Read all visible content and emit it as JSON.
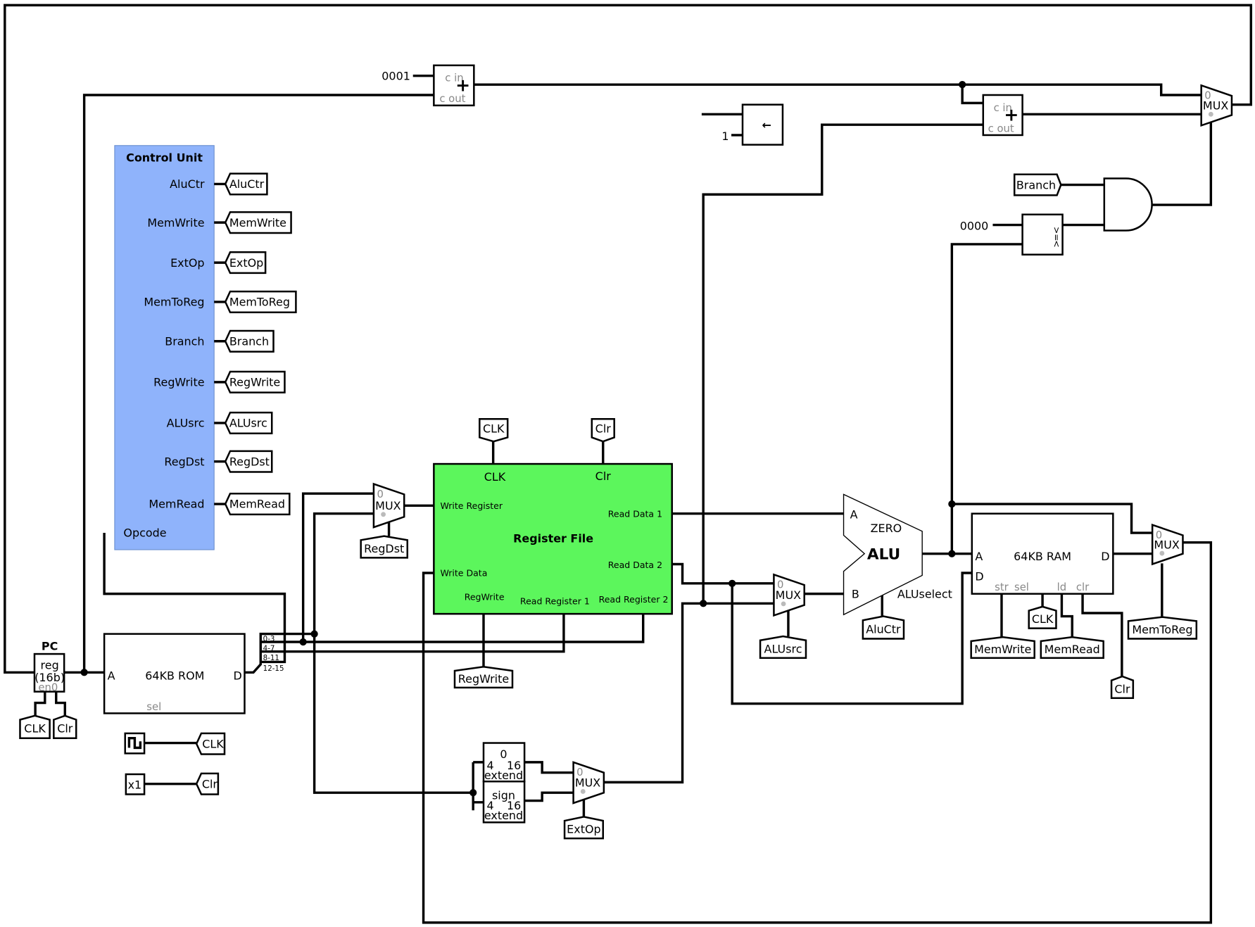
{
  "control_unit": {
    "title": "Control Unit",
    "outputs": [
      "AluCtr",
      "MemWrite",
      "ExtOp",
      "MemToReg",
      "Branch",
      "RegWrite",
      "ALUsrc",
      "RegDst",
      "MemRead"
    ],
    "input": "Opcode",
    "fill_color": "#8fb3fb"
  },
  "constants": {
    "one_hex": "0001",
    "zero_hex": "0000",
    "one": "1",
    "x1": "x1"
  },
  "adder": {
    "cin": "c in",
    "cout": "c out",
    "plus": "+"
  },
  "shift": {
    "arrow": "←"
  },
  "comparator": {
    "gt": ">",
    "eq": "=",
    "lt": "<"
  },
  "mux": {
    "label": "MUX",
    "zero": "0"
  },
  "pc": {
    "title": "PC",
    "line1": "reg",
    "line2": "(16b)",
    "en": "en0"
  },
  "rom": {
    "a": "A",
    "title": "64KB ROM",
    "d": "D",
    "sel": "sel"
  },
  "splitter": [
    "0-3",
    "4-7",
    "8-11",
    "12-15"
  ],
  "register_file": {
    "title": "Register File",
    "clk": "CLK",
    "clr": "Clr",
    "write_register": "Write Register",
    "read_data_1": "Read Data 1",
    "read_data_2": "Read Data 2",
    "write_data": "Write Data",
    "regwrite": "RegWrite",
    "read_register_1": "Read Register 1",
    "read_register_2": "Read Register 2",
    "fill_color": "#5cf65c"
  },
  "alu": {
    "a": "A",
    "b": "B",
    "zero": "ZERO",
    "title": "ALU",
    "select": "ALUselect"
  },
  "ram": {
    "a": "A",
    "d_in": "D",
    "title": "64KB RAM",
    "d_out": "D",
    "str": "str",
    "sel": "sel",
    "ld": "ld",
    "clr": "clr"
  },
  "zero_extend": {
    "top": "0",
    "bits_in": "4",
    "bits_out": "16",
    "bottom": "extend"
  },
  "sign_extend": {
    "top": "sign",
    "bits_in": "4",
    "bits_out": "16",
    "bottom": "extend"
  },
  "tunnels": {
    "clk": "CLK",
    "clr": "Clr",
    "branch": "Branch",
    "regdst": "RegDst",
    "regwrite": "RegWrite",
    "alusrc": "ALUsrc",
    "aluctr": "AluCtr",
    "memwrite": "MemWrite",
    "memread": "MemRead",
    "memtoreg": "MemToReg",
    "extop": "ExtOp"
  }
}
